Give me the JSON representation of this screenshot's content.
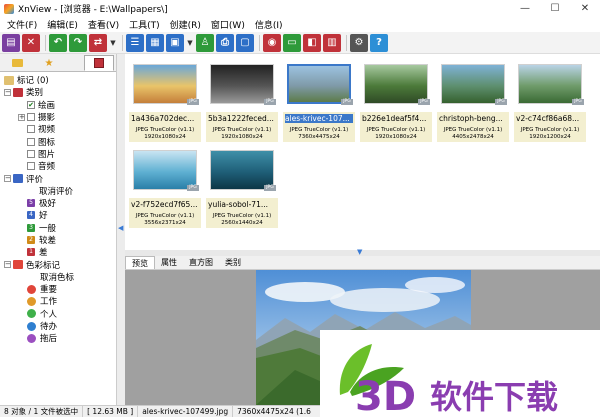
{
  "window": {
    "title": "XnView - [浏览器 - E:\\Wallpapers\\]",
    "controls": {
      "minimize": "—",
      "maximize": "☐",
      "close": "✕"
    }
  },
  "menu": [
    "文件(F)",
    "编辑(E)",
    "查看(V)",
    "工具(T)",
    "创建(R)",
    "窗口(W)",
    "信息(I)"
  ],
  "toolbar": {
    "buttons": [
      {
        "icon": "open-folder-icon",
        "color": "#7a3fa0"
      },
      {
        "icon": "close-image-icon",
        "color": "#c0323a"
      },
      {
        "icon": "rotate-left-icon",
        "color": "#2e9a3a"
      },
      {
        "icon": "rotate-right-icon",
        "color": "#2e9a3a"
      },
      {
        "icon": "convert-icon",
        "color": "#c0323a"
      },
      {
        "icon": "list-view-icon",
        "color": "#2d6fc7"
      },
      {
        "icon": "details-view-icon",
        "color": "#2d6fc7"
      },
      {
        "icon": "thumbnail-view-icon",
        "color": "#2d6fc7"
      },
      {
        "icon": "user-icon",
        "color": "#2e9a3a"
      },
      {
        "icon": "print-icon",
        "color": "#2d6fc7"
      },
      {
        "icon": "scan-icon",
        "color": "#2d6fc7"
      },
      {
        "icon": "camera-icon",
        "color": "#c0323a"
      },
      {
        "icon": "slideshow-icon",
        "color": "#2e9a3a"
      },
      {
        "icon": "compare-icon",
        "color": "#c0323a"
      },
      {
        "icon": "multi-page-icon",
        "color": "#c0323a"
      },
      {
        "icon": "settings-icon",
        "color": "#555555"
      },
      {
        "icon": "help-icon",
        "color": "#2d8fd6"
      }
    ]
  },
  "left_tabs": [
    {
      "icon": "folder-icon"
    },
    {
      "icon": "favorites-icon"
    },
    {
      "icon": "categories-icon"
    }
  ],
  "tree": {
    "tagged": "标记 (0)",
    "categories": "类别",
    "category_items": [
      {
        "label": "绘画",
        "checked": true
      },
      {
        "label": "摄影",
        "checked": false
      },
      {
        "label": "视频",
        "checked": false
      },
      {
        "label": "图标",
        "checked": false
      },
      {
        "label": "图片",
        "checked": false
      },
      {
        "label": "音频",
        "checked": false
      }
    ],
    "rating": "评价",
    "rating_items": [
      {
        "label": "取消评价",
        "badge": "",
        "color": ""
      },
      {
        "label": "极好",
        "badge": "5",
        "color": "#7b3fa8"
      },
      {
        "label": "好",
        "badge": "4",
        "color": "#3a66c4"
      },
      {
        "label": "一般",
        "badge": "3",
        "color": "#2e9a3a"
      },
      {
        "label": "较差",
        "badge": "2",
        "color": "#d08a18"
      },
      {
        "label": "差",
        "badge": "1",
        "color": "#c0323a"
      }
    ],
    "color_labels": "色彩标记",
    "color_items": [
      {
        "label": "取消色标",
        "color": ""
      },
      {
        "label": "重要",
        "color": "#e0453a"
      },
      {
        "label": "工作",
        "color": "#e09a2a"
      },
      {
        "label": "个人",
        "color": "#3fb04a"
      },
      {
        "label": "待办",
        "color": "#2f7fd0"
      },
      {
        "label": "拖后",
        "color": "#9b4fc0"
      }
    ]
  },
  "thumbnails": [
    {
      "name": "1a436a702dec...",
      "format": "JPEG TrueColor (v1.1)",
      "size": "1920x1080x24",
      "colors": [
        "#6aa7d8",
        "#e9c46a",
        "#c47f3a"
      ],
      "selected": false
    },
    {
      "name": "5b3a1222feced...",
      "format": "JPEG TrueColor (v1.1)",
      "size": "1920x1080x24",
      "colors": [
        "#222222",
        "#555555",
        "#999999"
      ],
      "selected": false
    },
    {
      "name": "ales-krivec-107...",
      "format": "JPEG TrueColor (v1.1)",
      "size": "7360x4475x24",
      "colors": [
        "#9cc2e0",
        "#7f9aa8",
        "#5c7b4a"
      ],
      "selected": true
    },
    {
      "name": "b226e1deaf5f4...",
      "format": "JPEG TrueColor (v1.1)",
      "size": "1920x1080x24",
      "colors": [
        "#a7c9a0",
        "#4c7a3a",
        "#2f4a26"
      ],
      "selected": false
    },
    {
      "name": "christoph-beng...",
      "format": "JPEG TrueColor (v1.1)",
      "size": "4405x2478x24",
      "colors": [
        "#7fb2d6",
        "#5e8f6f",
        "#35612e"
      ],
      "selected": false
    },
    {
      "name": "v2-c74cf86a68...",
      "format": "JPEG TrueColor (v1.1)",
      "size": "1920x1200x24",
      "colors": [
        "#b9d3e6",
        "#6f9b6a",
        "#3a6a34"
      ],
      "selected": false
    },
    {
      "name": "v2-f752ecd7f65...",
      "format": "JPEG TrueColor (v1.1)",
      "size": "3556x2371x24",
      "colors": [
        "#c9e4f2",
        "#5fb0d2",
        "#2a7fa8"
      ],
      "selected": false
    },
    {
      "name": "yulia-sobol-71...",
      "format": "JPEG TrueColor (v1.1)",
      "size": "2560x1440x24",
      "colors": [
        "#3f8fa8",
        "#1f5f78",
        "#0d3646"
      ],
      "selected": false
    }
  ],
  "thumb_badge": "JPG",
  "preview_tabs": [
    "预览",
    "属性",
    "直方图",
    "类别"
  ],
  "status": {
    "count": "8 对象 / 1 文件被选中",
    "size": "[ 12.63 MB ]",
    "file": "ales-krivec-107499.jpg",
    "dims": "7360x4475x24 (1.6"
  },
  "watermark": "3D软件下载"
}
